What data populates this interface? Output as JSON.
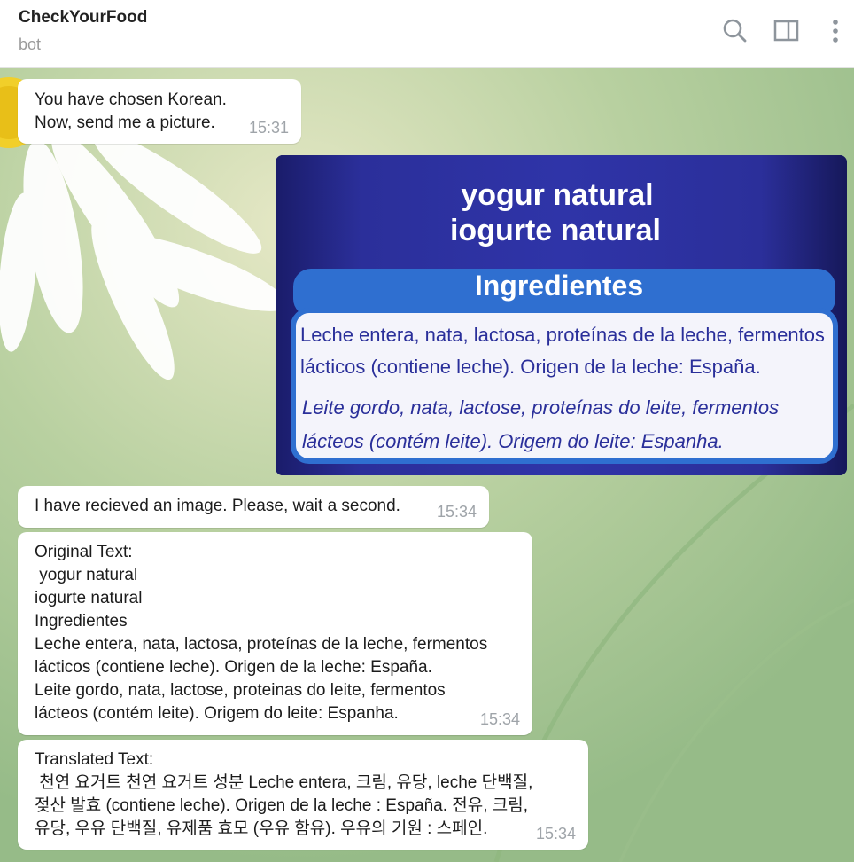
{
  "header": {
    "title": "CheckYourFood",
    "subtitle": "bot",
    "icons": [
      "search-icon",
      "sidebar-toggle-icon",
      "more-vertical-icon"
    ]
  },
  "messages": [
    {
      "text": "You have chosen Korean.\nNow, send me a picture.",
      "time": "15:31"
    },
    {
      "type": "photo",
      "photo_text": {
        "line1": "yogur natural",
        "line2": "iogurte natural",
        "heading": "Ingredientes",
        "es_line1": "Leche entera, nata, lactosa, proteínas de la leche, fermentos",
        "es_line2": "lácticos (contiene leche). Origen de la leche: España.",
        "pt_line1": "Leite gordo, nata, lactose, proteínas do leite, fermentos",
        "pt_line2": "lácteos (contém leite). Origem do leite: Espanha."
      }
    },
    {
      "text": "I have recieved an image. Please, wait a second.",
      "time": "15:34"
    },
    {
      "text": "Original Text:\n yogur natural\niogurte natural\nIngredientes\nLeche entera, nata, lactosa, proteínas de la leche, fermentos\nlácticos (contiene leche). Origen de la leche: España.\nLeite gordo, nata, lactose, proteinas do leite, fermentos\nlácteos (contém leite). Origem do leite: Espanha.",
      "time": "15:34"
    },
    {
      "text": "Translated Text:\n 천연 요거트 천연 요거트 성분 Leche entera, 크림, 유당, leche 단백질,\n젖산 발효 (contiene leche). Origen de la leche : España. 전유, 크림,\n유당, 우유 단백질, 유제품 효모 (우유 함유). 우유의 기원 : 스페인.",
      "time": "15:34"
    }
  ],
  "colors": {
    "bubble_bg": "#ffffff",
    "timestamp": "#9fa4a9",
    "photo_bg": "#24268a",
    "label_band": "#2f6fd0"
  }
}
